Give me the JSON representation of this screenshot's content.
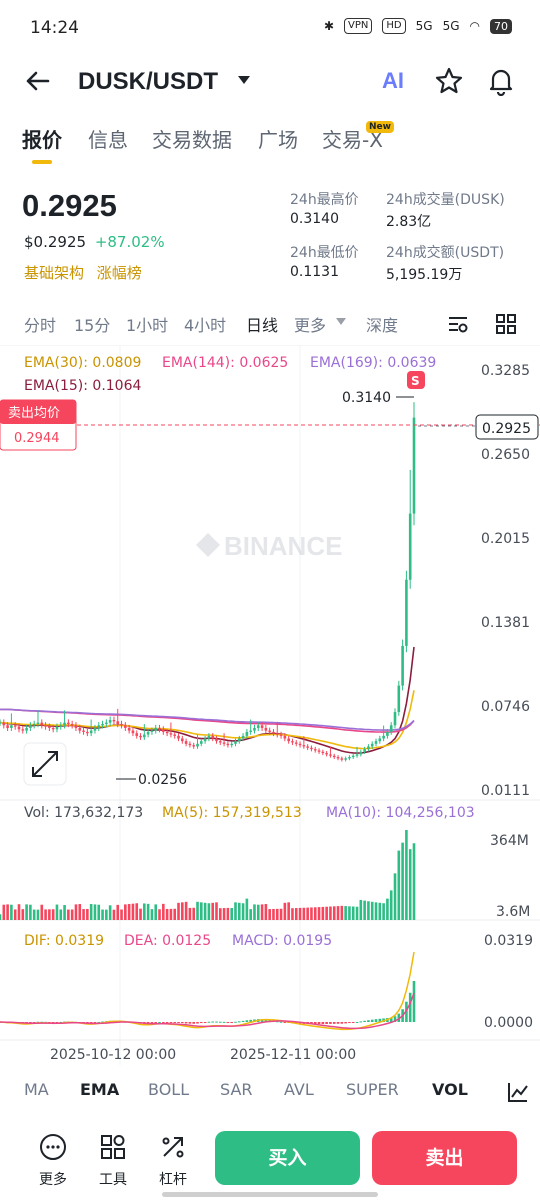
{
  "status_bar": {
    "time": "14:24",
    "vpn": "VPN",
    "hd": "HD",
    "net1": "5G",
    "net2": "5G",
    "battery": "70"
  },
  "header": {
    "pair": "DUSK/USDT",
    "ai_label": "AI"
  },
  "tabs": [
    {
      "label": "报价",
      "active": true
    },
    {
      "label": "信息"
    },
    {
      "label": "交易数据"
    },
    {
      "label": "广场"
    },
    {
      "label": "交易-X",
      "badge": "New"
    }
  ],
  "price": {
    "last": "0.2925",
    "usd": "$0.2925",
    "change": "+87.02%",
    "tag1": "基础架构",
    "tag2": "涨幅榜"
  },
  "stats": {
    "high_label": "24h最高价",
    "high": "0.3140",
    "vol_base_label": "24h成交量(DUSK)",
    "vol_base": "2.83亿",
    "low_label": "24h最低价",
    "low": "0.1131",
    "vol_quote_label": "24h成交额(USDT)",
    "vol_quote": "5,195.19万"
  },
  "intervals": [
    "分时",
    "15分",
    "1小时",
    "4小时",
    "日线",
    "更多",
    "深度"
  ],
  "selected_interval": "日线",
  "chart_data": {
    "type": "candlestick",
    "ema_legend": {
      "ema30": "EMA(30): 0.0809",
      "ema144": "EMA(144): 0.0625",
      "ema169": "EMA(169): 0.0639",
      "ema15": "EMA(15): 0.1064"
    },
    "y_ticks": [
      "0.3285",
      "0.2650",
      "0.2015",
      "0.1381",
      "0.0746",
      "0.0111"
    ],
    "ylim": [
      0.0111,
      0.3285
    ],
    "current_price_tag": "0.2925",
    "avg_sell_label": "卖出均价",
    "avg_sell_price": "0.2944",
    "high_marker": "0.3140",
    "low_marker": "0.0256",
    "sell_marker": "S",
    "watermark": "BINANCE",
    "closes": [
      0.062,
      0.06,
      0.058,
      0.06,
      0.059,
      0.057,
      0.056,
      0.058,
      0.06,
      0.061,
      0.062,
      0.06,
      0.059,
      0.058,
      0.057,
      0.059,
      0.06,
      0.062,
      0.061,
      0.06,
      0.058,
      0.056,
      0.055,
      0.054,
      0.056,
      0.058,
      0.06,
      0.061,
      0.062,
      0.064,
      0.063,
      0.061,
      0.06,
      0.058,
      0.056,
      0.054,
      0.052,
      0.051,
      0.053,
      0.055,
      0.056,
      0.058,
      0.057,
      0.055,
      0.054,
      0.053,
      0.052,
      0.05,
      0.048,
      0.046,
      0.045,
      0.044,
      0.046,
      0.048,
      0.05,
      0.052,
      0.05,
      0.048,
      0.047,
      0.046,
      0.045,
      0.046,
      0.048,
      0.05,
      0.052,
      0.055,
      0.056,
      0.058,
      0.06,
      0.058,
      0.056,
      0.055,
      0.054,
      0.053,
      0.052,
      0.05,
      0.048,
      0.047,
      0.046,
      0.045,
      0.044,
      0.043,
      0.042,
      0.041,
      0.04,
      0.039,
      0.038,
      0.037,
      0.036,
      0.035,
      0.034,
      0.035,
      0.036,
      0.037,
      0.038,
      0.04,
      0.042,
      0.044,
      0.046,
      0.048,
      0.05,
      0.052,
      0.055,
      0.06,
      0.07,
      0.09,
      0.12,
      0.17,
      0.22,
      0.2925
    ],
    "volume": {
      "legend": "Vol: 173,632,173",
      "ma5": "MA(5): 157,319,513",
      "ma10": "MA(10): 104,256,103",
      "y_ticks": [
        "364M",
        "3.6M"
      ]
    },
    "macd": {
      "dif": "DIF: 0.0319",
      "dea": "DEA: 0.0125",
      "macd": "MACD: 0.0195",
      "y_ticks": [
        "0.0319",
        "0.0000"
      ]
    },
    "x_ticks": [
      "2025-10-12 00:00",
      "2025-12-11 00:00"
    ]
  },
  "indicator_tabs": [
    "MA",
    "EMA",
    "BOLL",
    "SAR",
    "AVL",
    "SUPER",
    "VOL"
  ],
  "bottom": {
    "more": "更多",
    "tools": "工具",
    "leverage": "杠杆",
    "buy": "买入",
    "sell": "卖出"
  },
  "colors": {
    "up": "#2ebd85",
    "down": "#f6465d",
    "accent": "#f0b90b"
  }
}
